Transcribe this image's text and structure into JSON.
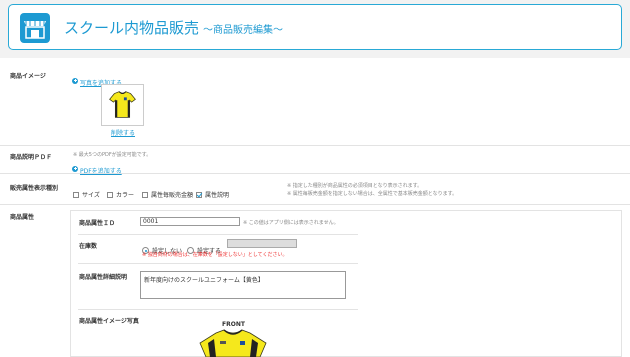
{
  "header": {
    "title": "スクール内物品販売",
    "subtitle": "～商品販売編集～"
  },
  "image_row": {
    "label": "商品イメージ",
    "add_link": "写真を追加する",
    "delete_link": "削除する"
  },
  "pdf_row": {
    "label": "商品説明ＰＤＦ",
    "note": "※ 最大5つのPDFが設定可能です。",
    "add_link": "PDFを追加する"
  },
  "attr_type_row": {
    "label": "販売属性表示種別",
    "options": [
      {
        "label": "サイズ",
        "checked": false
      },
      {
        "label": "カラー",
        "checked": false
      },
      {
        "label": "属性毎販売金額",
        "checked": false
      },
      {
        "label": "属性説明",
        "checked": true
      }
    ],
    "note1": "※ 指定した種別が商品属性の必須項目となり表示されます。",
    "note2": "※ 属性毎販売金額を指定しない場合は、全属性で基本販売金額となります。"
  },
  "attr_row": {
    "label": "商品属性",
    "id_label": "商品属性ＩＤ",
    "id_value": "0001",
    "id_note": "※ この値はアプリ側には表示されません。",
    "stock_label": "在庫数",
    "stock_options": [
      {
        "label": "設定しない",
        "checked": true
      },
      {
        "label": "設定する",
        "checked": false
      }
    ],
    "stock_note": "※ 独自商材の場合は、在庫数を「設定しない」としてください。",
    "desc_label": "商品属性詳細説明",
    "desc_value": "新年度向けのスクールユニフォーム【黄色】",
    "image_label": "商品属性イメージ写真",
    "front_label": "FRONT"
  },
  "colors": {
    "accent": "#1d9ad2",
    "shirt": "#f5e81c",
    "warning": "#e33333"
  }
}
